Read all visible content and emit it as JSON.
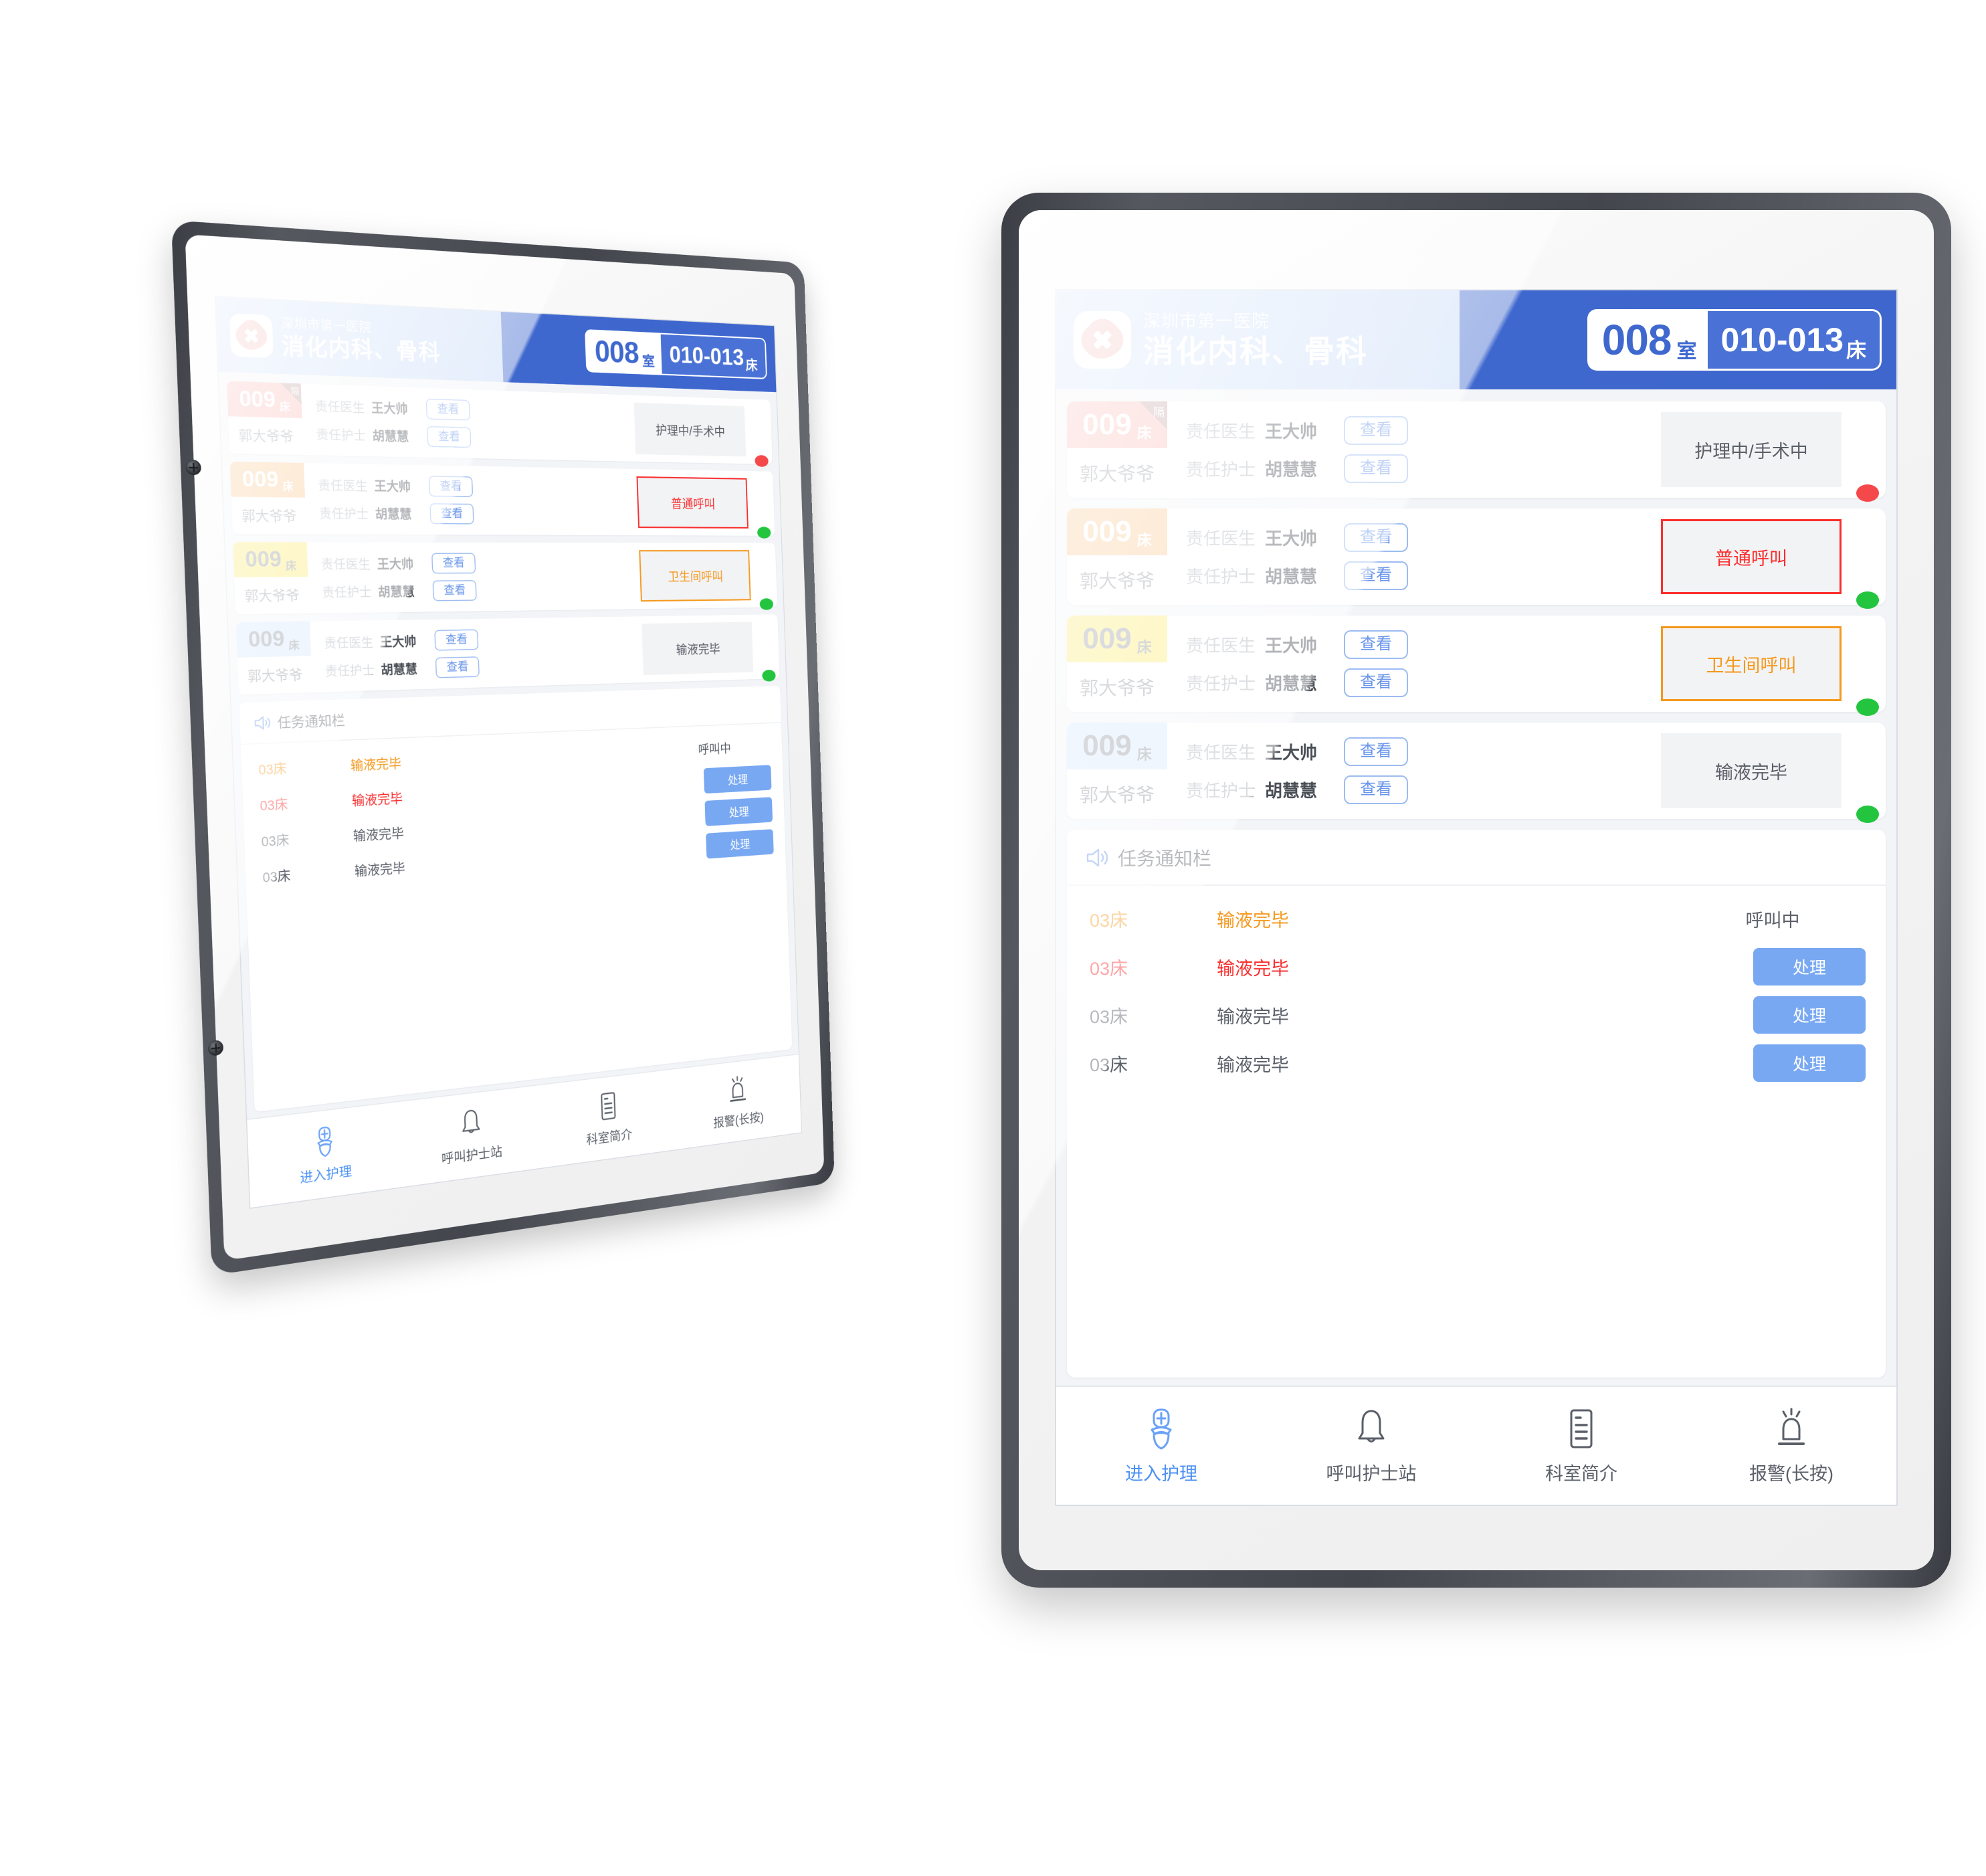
{
  "header": {
    "hospital": "深圳市第一医院",
    "department": "消化内科、骨科",
    "room_number": "008",
    "room_unit": "室",
    "bed_range": "010-013",
    "bed_range_unit": "床",
    "logo_icon": "hospital-cross-icon",
    "accent_blue": "#4a72d6",
    "header_left_bg": "#c6daf8"
  },
  "patients": [
    {
      "bed_no": "009",
      "bed_unit": "床",
      "bed_tag_bg": "#f8b3ae",
      "bed_no_color": "#ffffff",
      "isolation_badge": "隔",
      "name": "郭大爷爷",
      "doctor_role": "责任医生",
      "doctor_name": "王大帅",
      "nurse_role": "责任护士",
      "nurse_name": "胡慧慧",
      "view_label": "查看",
      "status_text": "护理中/手术中",
      "status_style": "plain",
      "dot": "red"
    },
    {
      "bed_no": "009",
      "bed_unit": "床",
      "bed_tag_bg": "#f9c489",
      "bed_no_color": "#ffffff",
      "isolation_badge": "",
      "name": "郭大爷爷",
      "doctor_role": "责任医生",
      "doctor_name": "王大帅",
      "nurse_role": "责任护士",
      "nurse_name": "胡慧慧",
      "view_label": "查看",
      "status_text": "普通呼叫",
      "status_style": "alert-red",
      "dot": "green"
    },
    {
      "bed_no": "009",
      "bed_unit": "床",
      "bed_tag_bg": "#fbe96a",
      "bed_no_color": "#8d939c",
      "isolation_badge": "",
      "name": "郭大爷爷",
      "doctor_role": "责任医生",
      "doctor_name": "王大帅",
      "nurse_role": "责任护士",
      "nurse_name": "胡慧慧",
      "view_label": "查看",
      "status_text": "卫生间呼叫",
      "status_style": "alert-orange",
      "dot": "green"
    },
    {
      "bed_no": "009",
      "bed_unit": "床",
      "bed_tag_bg": "#d6e7fb",
      "bed_no_color": "#8d939c",
      "isolation_badge": "",
      "name": "郭大爷爷",
      "doctor_role": "责任医生",
      "doctor_name": "王大帅",
      "nurse_role": "责任护士",
      "nurse_name": "胡慧慧",
      "view_label": "查看",
      "status_text": "输液完毕",
      "status_style": "plain",
      "dot": "green"
    }
  ],
  "task_panel": {
    "icon": "speaker-icon",
    "title": "任务通知栏",
    "rows": [
      {
        "bed": "03床",
        "message": "输液完毕",
        "color": "c-orange",
        "status_text": "呼叫中",
        "action_label": ""
      },
      {
        "bed": "03床",
        "message": "输液完毕",
        "color": "c-red",
        "status_text": "",
        "action_label": "处理"
      },
      {
        "bed": "03床",
        "message": "输液完毕",
        "color": "c-grey",
        "status_text": "",
        "action_label": "处理"
      },
      {
        "bed": "03床",
        "message": "输液完毕",
        "color": "c-grey",
        "status_text": "",
        "action_label": "处理"
      }
    ]
  },
  "bottom_nav": {
    "items": [
      {
        "label": "进入护理",
        "icon": "nurse-icon",
        "active": true
      },
      {
        "label": "呼叫护士站",
        "icon": "bell-icon",
        "active": false
      },
      {
        "label": "科室简介",
        "icon": "document-icon",
        "active": false
      },
      {
        "label": "报警(长按)",
        "icon": "alarm-light-icon",
        "active": false
      }
    ]
  }
}
